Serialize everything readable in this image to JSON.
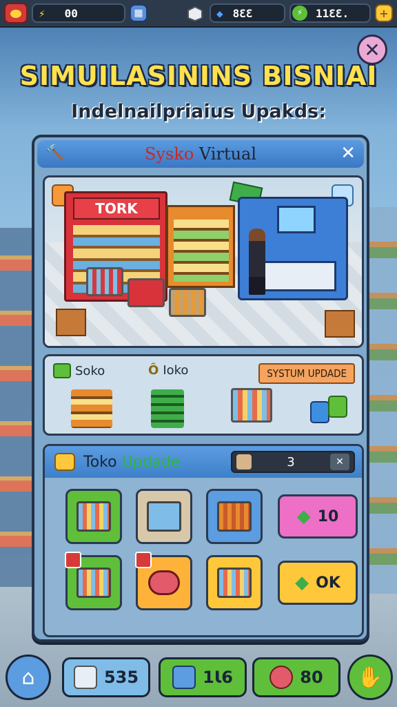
{
  "topbar": {
    "coins": "00",
    "gems": "8ƐƐ",
    "energy": "11ƐƐ.",
    "icons": [
      "alarm-icon",
      "lightning-icon",
      "calculator-icon",
      "box-icon",
      "gem-icon",
      "green-energy-icon",
      "plus-icon"
    ]
  },
  "title": "SIMUILASININS BISNIAI",
  "subtitle": "Indelnailpriaius Upakds:",
  "panel": {
    "title_a": "Sysko",
    "title_b": " Virtual"
  },
  "scene": {
    "store_sign": "TORK"
  },
  "categories": [
    {
      "label": "Soko",
      "icon": "green-box-icon"
    },
    {
      "label": "Ioko",
      "prefix": "Ô",
      "icon": "coin-icon"
    }
  ],
  "system_update": "SYSTUM UPDADE",
  "toko": {
    "label_a": "Toko ",
    "label_b": "Updade",
    "counter_value": "3",
    "counter_close": "✕"
  },
  "tiles": {
    "pink_value": "10",
    "yellow_value": "OK"
  },
  "bottombar": {
    "btn1_value": "535",
    "btn2_value": "1Ɩ6",
    "btn3_value": "80"
  },
  "colors": {
    "accent": "#3d80ca",
    "title": "#ffe14d",
    "green": "#5fbf3a",
    "pink": "#ee6fc6",
    "yellow": "#ffc83a",
    "orange": "#f5a35e"
  }
}
